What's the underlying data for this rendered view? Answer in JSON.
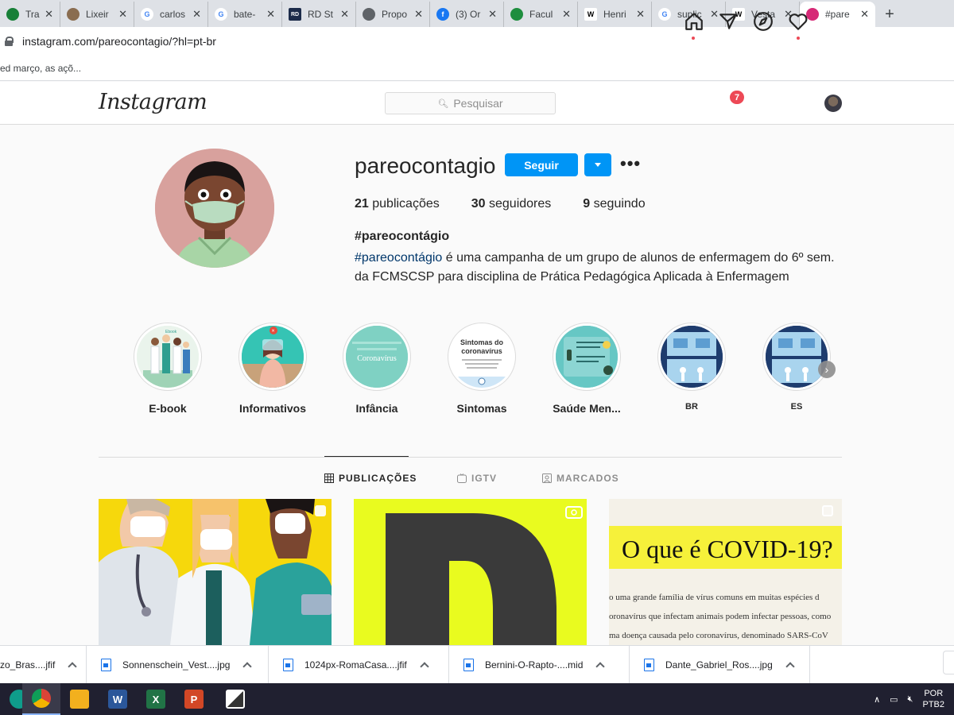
{
  "browser": {
    "tabs": [
      {
        "title": "Trans",
        "icon": "green-circle-icon",
        "color": "#188038"
      },
      {
        "title": "Lixeir",
        "icon": "hedgehog-icon",
        "color": "#8a6d50"
      },
      {
        "title": "carlos",
        "icon": "google-icon",
        "color": "#4285f4"
      },
      {
        "title": "bate-",
        "icon": "google-icon",
        "color": "#4285f4"
      },
      {
        "title": "RD St",
        "icon": "rd-icon",
        "color": "#1c2b4a"
      },
      {
        "title": "Propo",
        "icon": "globe-icon",
        "color": "#5f6368"
      },
      {
        "title": "(3) Or",
        "icon": "facebook-icon",
        "color": "#1877f2"
      },
      {
        "title": "Facul",
        "icon": "green-arrow-icon",
        "color": "#1e8e3e"
      },
      {
        "title": "Henri",
        "icon": "wikipedia-icon",
        "color": "#ffffff"
      },
      {
        "title": "suplic",
        "icon": "google-icon",
        "color": "#4285f4"
      },
      {
        "title": "Vesta",
        "icon": "wikipedia-icon",
        "color": "#ffffff"
      },
      {
        "title": "#pare",
        "icon": "instagram-icon",
        "color": "#d62976",
        "active": true
      }
    ],
    "url": "instagram.com/pareocontagio/?hl=pt-br",
    "bookmark_text": "ed março, as açõ..."
  },
  "instagram": {
    "logo": "Instagram",
    "search_placeholder": "Pesquisar",
    "direct_badge": "7",
    "profile": {
      "username": "pareocontagio",
      "follow_label": "Seguir",
      "options_label": "•••",
      "stats": [
        {
          "count": "21",
          "label": "publicações"
        },
        {
          "count": "30",
          "label": "seguidores"
        },
        {
          "count": "9",
          "label": "seguindo"
        }
      ],
      "full_name": "#pareocontágio",
      "bio_hashtag": "#pareocontágio",
      "bio_line1_rest": " é uma campanha de um grupo de alunos de enfermagem do 6º sem.",
      "bio_line2": "da FCMSCSP para disciplina de Prática Pedagógica Aplicada à Enfermagem"
    },
    "highlights": [
      {
        "label": "E-book",
        "overlay": "Ebook"
      },
      {
        "label": "Informativos",
        "overlay": ""
      },
      {
        "label": "Infância",
        "overlay": "Coronavírus"
      },
      {
        "label": "Sintomas",
        "overlay": "Sintomas do coronavírus"
      },
      {
        "label": "Saúde Men...",
        "overlay": ""
      },
      {
        "label": "BR",
        "overlay": ""
      },
      {
        "label": "ES",
        "overlay": ""
      }
    ],
    "profile_tabs": [
      {
        "label": "PUBLICAÇÕES",
        "icon": "grid-icon",
        "active": true
      },
      {
        "label": "IGTV",
        "icon": "igtv-icon",
        "active": false
      },
      {
        "label": "MARCADOS",
        "icon": "tagged-icon",
        "active": false
      }
    ],
    "posts": {
      "post3_title": "O que é COVID-19?",
      "post3_lines": [
        "o uma grande família de vírus comuns em muitas espécies d",
        "oronavírus que infectam animais podem infectar pessoas, como",
        "ma doença causada pelo coronavírus, denominado SARS-CoV"
      ],
      "post2_letter": "D"
    }
  },
  "downloads": [
    {
      "name": "zo_Bras....jfif"
    },
    {
      "name": "Sonnenschein_Vest....jpg"
    },
    {
      "name": "1024px-RomaCasa....jfif"
    },
    {
      "name": "Bernini-O-Rapto-....mid"
    },
    {
      "name": "Dante_Gabriel_Ros....jpg"
    }
  ],
  "taskbar": {
    "apps": [
      {
        "name": "edge-icon",
        "color": "#0f9d8b",
        "text": ""
      },
      {
        "name": "chrome-icon",
        "color": "#db4437",
        "text": ""
      },
      {
        "name": "file-explorer-icon",
        "color": "#f2b01e",
        "text": ""
      },
      {
        "name": "word-icon",
        "color": "#2b579a",
        "text": "W"
      },
      {
        "name": "excel-icon",
        "color": "#217346",
        "text": "X"
      },
      {
        "name": "powerpoint-icon",
        "color": "#d24726",
        "text": "P"
      },
      {
        "name": "photos-icon",
        "color": "#444444",
        "text": ""
      }
    ],
    "lang_line1": "POR",
    "lang_line2": "PTB2"
  }
}
